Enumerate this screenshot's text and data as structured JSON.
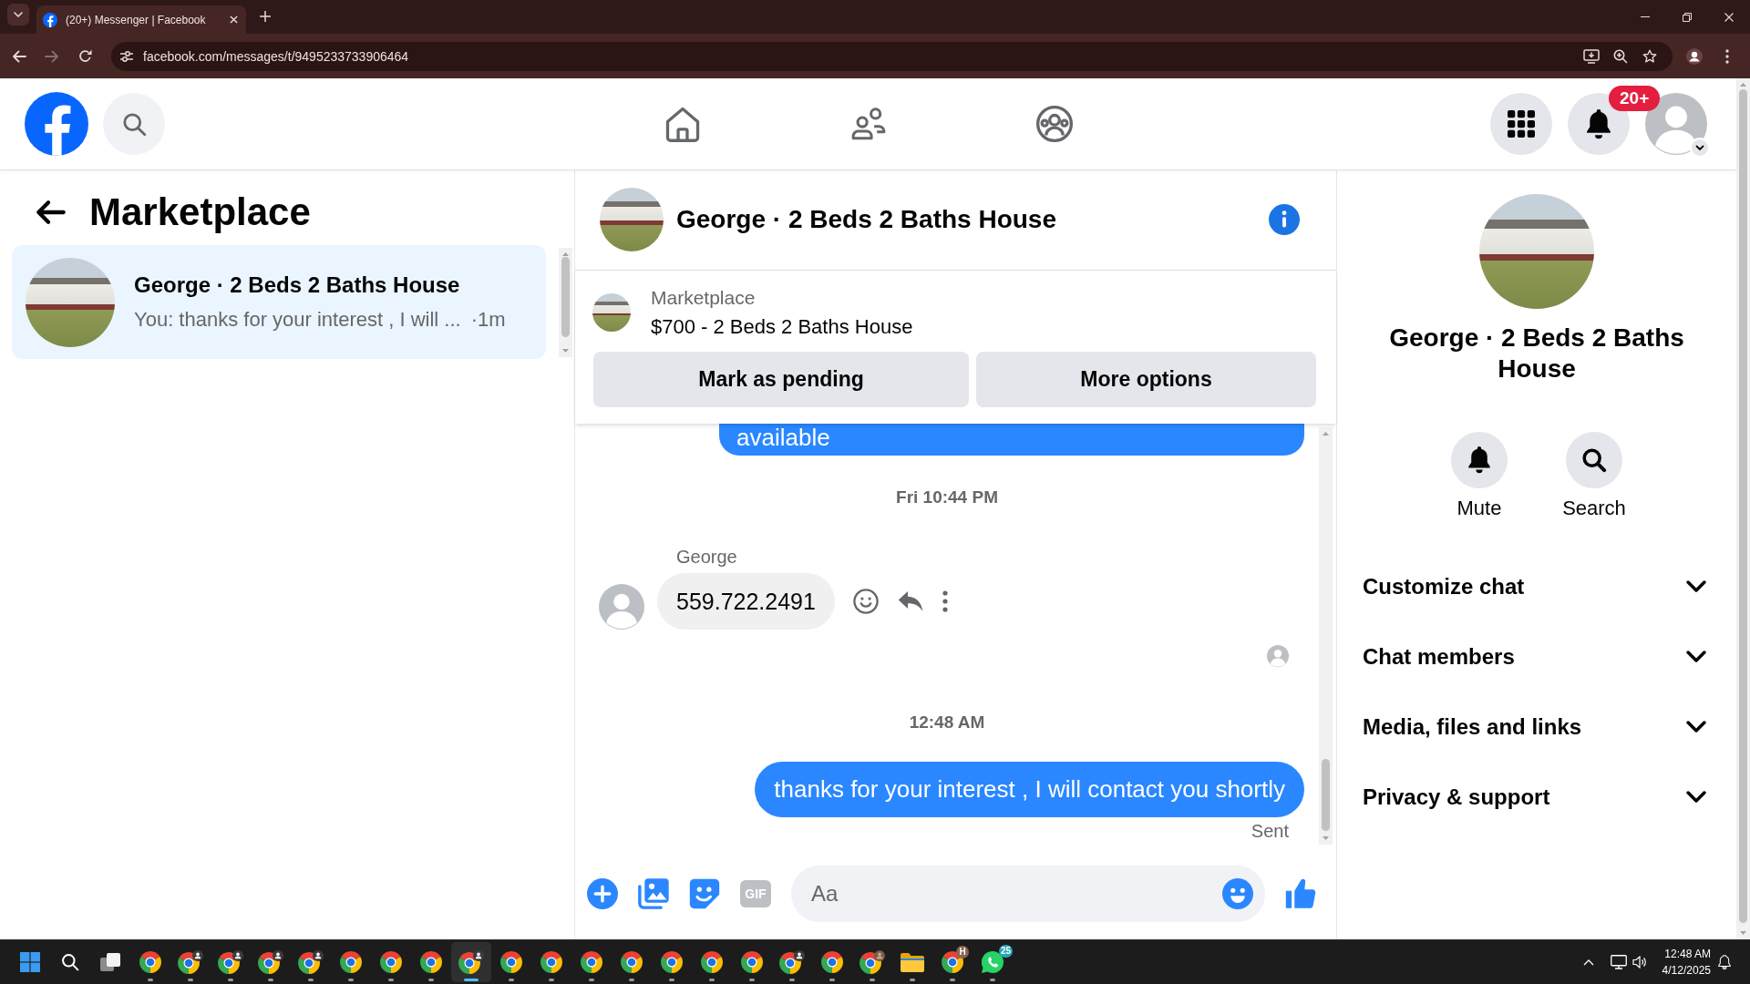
{
  "browser": {
    "tab": {
      "title": "(20+) Messenger | Facebook",
      "selected": true
    },
    "nav_buttons": [
      {
        "kind": "back",
        "disabled": false
      },
      {
        "kind": "forward",
        "disabled": true
      },
      {
        "kind": "reload",
        "disabled": false
      }
    ],
    "address": "facebook.com/messages/t/9495233733906464"
  },
  "header": {
    "notifications_badge": "20+"
  },
  "sidebar": {
    "title": "Marketplace",
    "conversations": [
      {
        "name": "George · 2 Beds 2 Baths House",
        "preview": "You: thanks for your interest , I will ...",
        "time": "·1m",
        "selected": true
      }
    ]
  },
  "chat": {
    "title": "George · 2 Beds 2 Baths House",
    "listing": {
      "label": "Marketplace",
      "title": "$700 - 2 Beds 2 Baths House",
      "buttons": [
        "Mark as pending",
        "More options"
      ]
    },
    "messages": [
      {
        "kind": "outgoing",
        "text": "available"
      },
      {
        "kind": "time",
        "text": "Fri 10:44 PM"
      },
      {
        "kind": "incoming",
        "sender": "George",
        "text": "559.722.2491"
      },
      {
        "kind": "seen"
      },
      {
        "kind": "time",
        "text": "12:48 AM"
      },
      {
        "kind": "outgoing",
        "text": "thanks for your interest , I will contact you shortly",
        "status": "Sent"
      }
    ],
    "composer": {
      "gif_label": "GIF",
      "placeholder": "Aa"
    }
  },
  "details": {
    "title": "George · 2 Beds 2 Baths House",
    "actions": [
      {
        "kind": "mute",
        "label": "Mute"
      },
      {
        "kind": "search",
        "label": "Search"
      }
    ],
    "sections": [
      {
        "label": "Customize chat",
        "expanded": false
      },
      {
        "label": "Chat members",
        "expanded": false
      },
      {
        "label": "Media, files and links",
        "expanded": false
      },
      {
        "label": "Privacy & support",
        "expanded": false
      }
    ]
  },
  "taskbar": {
    "apps": [
      {
        "kind": "chrome",
        "selected": false
      },
      {
        "kind": "chrome-person",
        "selected": false
      },
      {
        "kind": "chrome-person",
        "selected": false
      },
      {
        "kind": "chrome-person",
        "selected": false
      },
      {
        "kind": "chrome-person",
        "selected": false
      },
      {
        "kind": "chrome",
        "selected": false
      },
      {
        "kind": "chrome",
        "selected": false
      },
      {
        "kind": "chrome",
        "selected": false
      },
      {
        "kind": "chrome-person",
        "selected": true
      },
      {
        "kind": "chrome",
        "selected": false
      },
      {
        "kind": "chrome",
        "selected": false
      },
      {
        "kind": "chrome",
        "selected": false
      },
      {
        "kind": "chrome",
        "selected": false
      },
      {
        "kind": "chrome",
        "selected": false
      },
      {
        "kind": "chrome",
        "selected": false
      },
      {
        "kind": "chrome",
        "selected": false
      },
      {
        "kind": "chrome-person",
        "selected": false
      },
      {
        "kind": "chrome",
        "selected": false
      },
      {
        "kind": "chrome-avatar",
        "selected": false
      },
      {
        "kind": "folder",
        "selected": false
      },
      {
        "kind": "chrome-letter",
        "badge": "H",
        "selected": false
      },
      {
        "kind": "whatsapp",
        "badge": "25",
        "selected": false
      }
    ],
    "time": "12:48 AM",
    "date": "4/12/2025"
  }
}
